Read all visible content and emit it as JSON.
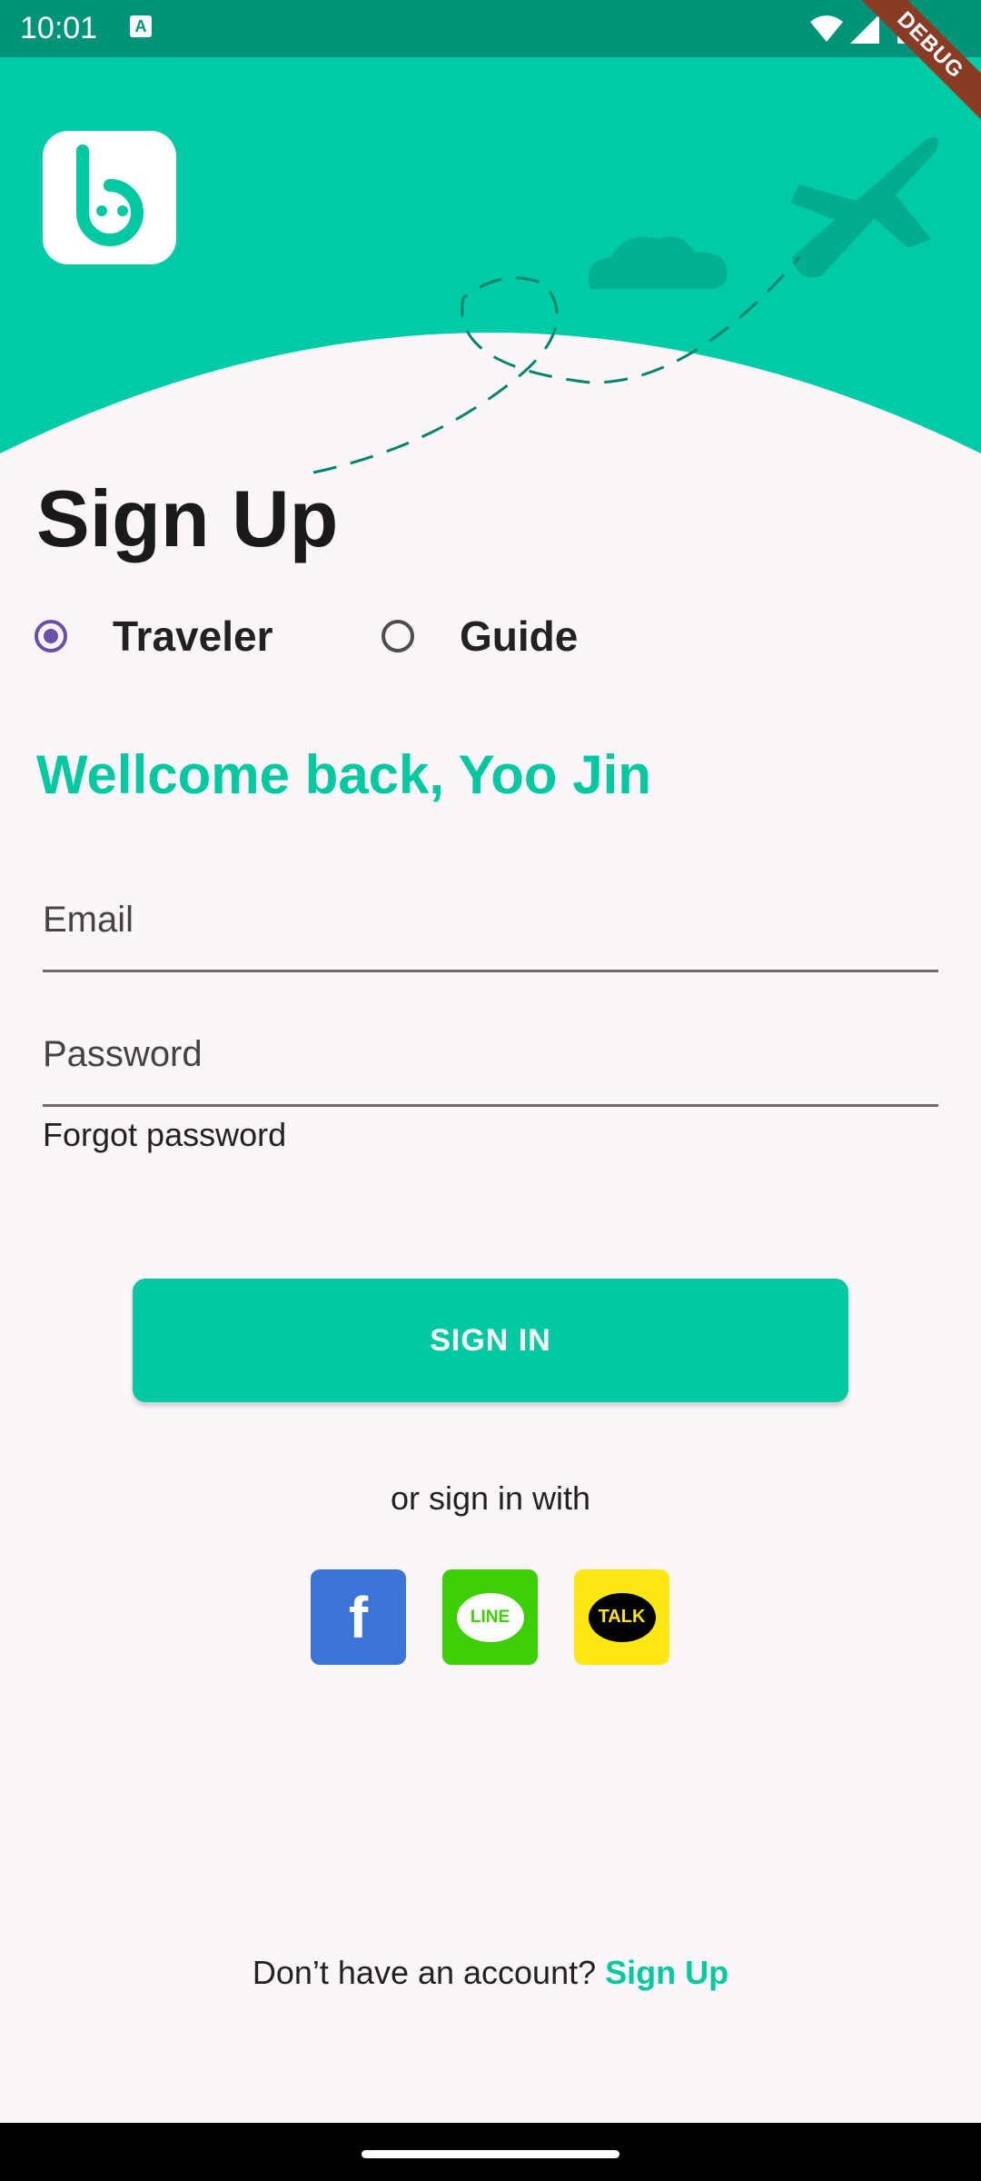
{
  "status_bar": {
    "time": "10:01",
    "notification_icon": "A"
  },
  "debug_banner": "DEBUG",
  "page": {
    "title": "Sign Up",
    "roles": [
      {
        "label": "Traveler",
        "selected": true
      },
      {
        "label": "Guide",
        "selected": false
      }
    ],
    "welcome": "Wellcome back, Yoo Jin"
  },
  "form": {
    "email_placeholder": "Email",
    "email_value": "",
    "password_placeholder": "Password",
    "password_value": "",
    "forgot_label": "Forgot password",
    "sign_in_label": "SIGN IN"
  },
  "social": {
    "or_text": "or sign in with",
    "items": [
      {
        "name": "facebook",
        "glyph": "f",
        "color": "#3a74d6"
      },
      {
        "name": "line",
        "glyph": "LINE",
        "color": "#3dce04"
      },
      {
        "name": "kakaotalk",
        "glyph": "TALK",
        "color": "#ffe812"
      }
    ]
  },
  "footer": {
    "prompt": "Don’t have an account?",
    "link": "Sign Up"
  },
  "colors": {
    "accent": "#00c9a2",
    "header_bg": "#00cba6",
    "status_bar": "#00937a",
    "radio_selected": "#6a4fa9"
  }
}
